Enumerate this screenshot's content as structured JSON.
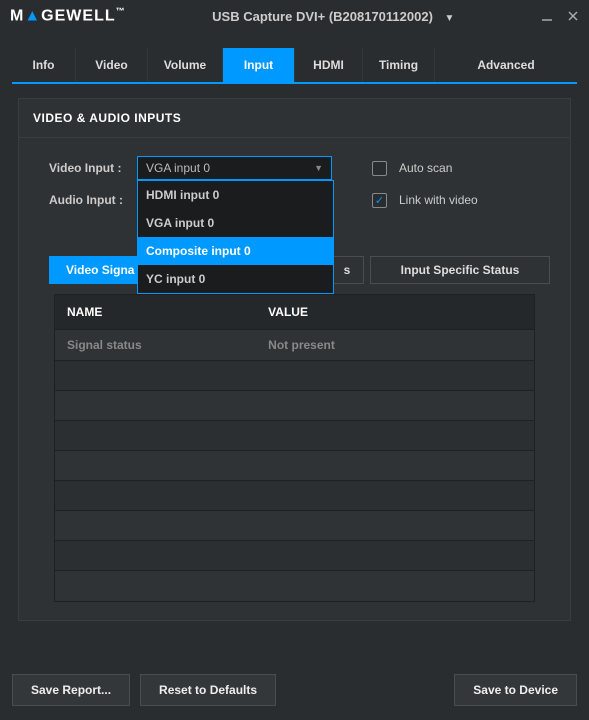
{
  "brand": "MAGEWELL",
  "device_title": "USB Capture DVI+ (B208170112002)",
  "tabs": [
    "Info",
    "Video",
    "Volume",
    "Input",
    "HDMI",
    "Timing",
    "Advanced"
  ],
  "active_tab": "Input",
  "panel": {
    "title": "VIDEO & AUDIO INPUTS",
    "video_label": "Video Input :",
    "audio_label": "Audio Input :",
    "video_select_value": "VGA input 0",
    "dropdown_options": [
      "HDMI input 0",
      "VGA input 0",
      "Composite input 0",
      "YC input 0"
    ],
    "dropdown_highlight": "Composite input 0",
    "auto_scan_label": "Auto scan",
    "auto_scan_checked": false,
    "link_video_label": "Link with video",
    "link_video_checked": true
  },
  "sub_tabs": {
    "active_label_prefix": "Video Signa",
    "stub_suffix": "s",
    "specific": "Input Specific Status"
  },
  "table": {
    "col_name": "NAME",
    "col_value": "VALUE",
    "rows": [
      {
        "name": "Signal status",
        "value": "Not present"
      },
      {
        "name": "",
        "value": ""
      },
      {
        "name": "",
        "value": ""
      },
      {
        "name": "",
        "value": ""
      },
      {
        "name": "",
        "value": ""
      },
      {
        "name": "",
        "value": ""
      },
      {
        "name": "",
        "value": ""
      },
      {
        "name": "",
        "value": ""
      },
      {
        "name": "",
        "value": ""
      }
    ]
  },
  "footer": {
    "save_report": "Save Report...",
    "reset": "Reset to Defaults",
    "save_device": "Save to Device"
  }
}
